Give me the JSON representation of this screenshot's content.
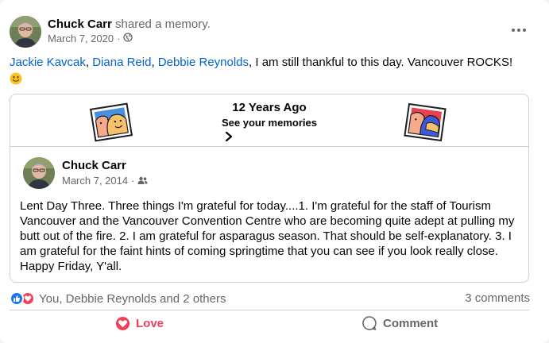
{
  "post": {
    "author": "Chuck Carr",
    "action": "shared a memory.",
    "date": "March 7, 2020",
    "visibility_icon": "globe-icon",
    "caption_mentions": [
      "Jackie Kavcak",
      "Diana Reid",
      "Debbie Reynolds"
    ],
    "caption_sep": ", ",
    "caption_text": ", I am still thankful to this day.  Vancouver ROCKS! ",
    "caption_emoji": "smiling-face-emoji"
  },
  "memory": {
    "years_ago": "12 Years Ago",
    "see_memories": "See your memories",
    "author": "Chuck Carr",
    "date": "March 7, 2014",
    "audience_icon": "friends-icon",
    "text": "Lent Day Three.  Three things I'm grateful for today....1. I'm grateful for the staff of Tourism Vancouver and the Vancouver Convention Centre who are becoming quite adept at pulling my butt out of the fire.   2. I am grateful for asparagus season.  That should be self-explanatory.  3. I am grateful for the faint hints of coming springtime that you can see if you look really close.    Happy Friday, Y'all."
  },
  "reactions": {
    "summary": "You, Debbie Reynolds and 2 others",
    "comments": "3 comments",
    "icons": [
      "like-reaction-icon",
      "love-reaction-icon"
    ]
  },
  "actions": {
    "love": "Love",
    "comment": "Comment"
  },
  "colors": {
    "link": "#0064d1",
    "love": "#f33e58",
    "like": "#1877f2",
    "secondary_text": "#65676b"
  }
}
